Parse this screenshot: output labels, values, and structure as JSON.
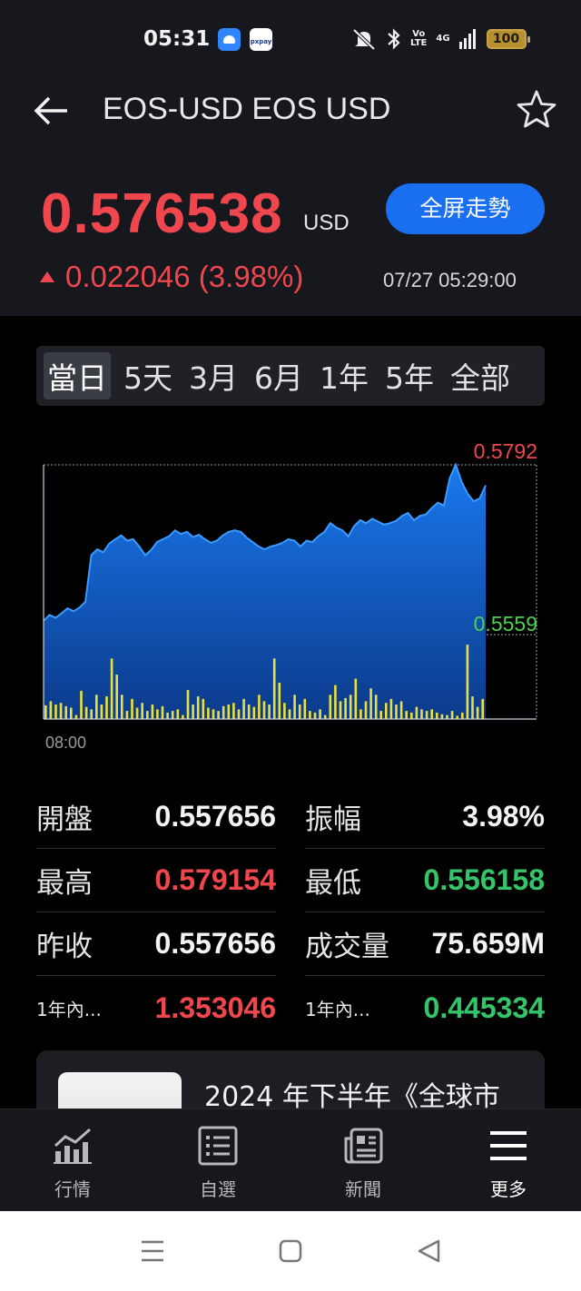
{
  "status_bar": {
    "time": "05:31",
    "app2_label": "pxpay",
    "volte": "Vo\nLTE",
    "network": "4G",
    "battery": "100"
  },
  "header": {
    "title": "EOS-USD EOS USD",
    "price": "0.576538",
    "price_unit": "USD",
    "fullscreen_label": "全屏走勢",
    "change": "0.022046 (3.98%)",
    "datetime": "07/27 05:29:00"
  },
  "range_tabs": [
    {
      "label": "當日",
      "active": true
    },
    {
      "label": "5天",
      "active": false
    },
    {
      "label": "3月",
      "active": false
    },
    {
      "label": "6月",
      "active": false
    },
    {
      "label": "1年",
      "active": false
    },
    {
      "label": "5年",
      "active": false
    },
    {
      "label": "全部",
      "active": false
    }
  ],
  "chart_data": {
    "type": "area",
    "high_label": "0.5792",
    "low_label": "0.5559",
    "x_label": "08:00",
    "ylim": [
      0.5559,
      0.5792
    ],
    "price": [
      0.5578,
      0.5586,
      0.5582,
      0.5588,
      0.5595,
      0.5591,
      0.5596,
      0.5604,
      0.5668,
      0.5676,
      0.5672,
      0.5684,
      0.569,
      0.5695,
      0.5688,
      0.569,
      0.568,
      0.5668,
      0.5675,
      0.5686,
      0.569,
      0.5694,
      0.5702,
      0.5697,
      0.57,
      0.5693,
      0.5696,
      0.569,
      0.5685,
      0.5688,
      0.5695,
      0.57,
      0.5702,
      0.57,
      0.5692,
      0.5686,
      0.568,
      0.5676,
      0.568,
      0.5682,
      0.5685,
      0.569,
      0.5688,
      0.568,
      0.5688,
      0.5686,
      0.5694,
      0.57,
      0.5712,
      0.5706,
      0.5702,
      0.5694,
      0.5708,
      0.5716,
      0.5712,
      0.5718,
      0.5714,
      0.571,
      0.5712,
      0.5715,
      0.5722,
      0.5726,
      0.5716,
      0.5722,
      0.5724,
      0.5733,
      0.574,
      0.5736,
      0.5774,
      0.5792,
      0.5768,
      0.5752,
      0.5742,
      0.5746,
      0.5764
    ],
    "volume": [
      0.17,
      0.22,
      0.18,
      0.2,
      0.16,
      0.14,
      0.05,
      0.35,
      0.15,
      0.12,
      0.3,
      0.18,
      0.28,
      0.75,
      0.55,
      0.3,
      0.1,
      0.25,
      0.14,
      0.2,
      0.1,
      0.18,
      0.12,
      0.16,
      0.08,
      0.1,
      0.12,
      0.05,
      0.36,
      0.18,
      0.28,
      0.25,
      0.14,
      0.12,
      0.1,
      0.16,
      0.18,
      0.2,
      0.12,
      0.25,
      0.18,
      0.15,
      0.3,
      0.22,
      0.18,
      0.75,
      0.45,
      0.2,
      0.12,
      0.3,
      0.18,
      0.25,
      0.1,
      0.08,
      0.12,
      0.05,
      0.3,
      0.42,
      0.22,
      0.26,
      0.3,
      0.5,
      0.12,
      0.22,
      0.38,
      0.3,
      0.1,
      0.2,
      0.25,
      0.18,
      0.22,
      0.1,
      0.08,
      0.15,
      0.12,
      0.1,
      0.12,
      0.08,
      0.06,
      0.05,
      0.1,
      0.04,
      0.08,
      0.92,
      0.28,
      0.15,
      0.25
    ]
  },
  "stats": [
    [
      {
        "label": "開盤",
        "value": "0.557656",
        "color": "#f4f4f4"
      },
      {
        "label": "振幅",
        "value": "3.98%",
        "color": "#f4f4f4"
      }
    ],
    [
      {
        "label": "最高",
        "value": "0.579154",
        "color": "#f0474f"
      },
      {
        "label": "最低",
        "value": "0.556158",
        "color": "#35c46a"
      }
    ],
    [
      {
        "label": "昨收",
        "value": "0.557656",
        "color": "#f4f4f4"
      },
      {
        "label": "成交量",
        "value": "75.659M",
        "color": "#f4f4f4"
      }
    ],
    [
      {
        "label": "1年內...",
        "value": "1.353046",
        "color": "#f0474f"
      },
      {
        "label": "1年內...",
        "value": "0.445334",
        "color": "#35c46a"
      }
    ]
  ],
  "news": {
    "title": "2024 年下半年《全球市"
  },
  "bottom_nav": [
    {
      "label": "行情",
      "icon": "chart-icon",
      "active": false
    },
    {
      "label": "自選",
      "icon": "watchlist-icon",
      "active": false
    },
    {
      "label": "新聞",
      "icon": "news-icon",
      "active": false
    },
    {
      "label": "更多",
      "icon": "menu-icon",
      "active": true
    }
  ],
  "colors": {
    "up": "#f0474f",
    "down": "#35c46a",
    "accent": "#1a6ff0",
    "chart_fill": "#1565d8",
    "volume": "#e8e040"
  }
}
